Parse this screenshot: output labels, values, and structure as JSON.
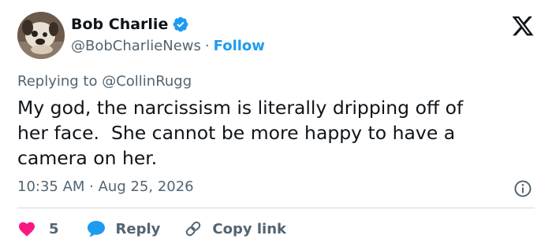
{
  "user": {
    "display_name": "Bob Charlie",
    "handle": "@BobCharlieNews",
    "separator": "·",
    "follow_label": "Follow",
    "verified_color": "#1d9bf0"
  },
  "tweet": {
    "replying_to": "Replying to @CollinRugg",
    "text": "My god, the narcissism is literally dripping off of\nher face.  She cannot be more happy to have a\ncamera on her.",
    "time": "10:35 AM · Aug 25, 2026"
  },
  "actions": {
    "like_count": "5",
    "reply_label": "Reply",
    "copy_link_label": "Copy link"
  },
  "icons": {
    "brand": "x-logo-icon",
    "verified": "verified-badge-icon",
    "info": "info-icon",
    "like": "heart-icon",
    "reply": "speech-bubble-icon",
    "copy": "link-icon"
  },
  "colors": {
    "like": "#f91880",
    "reply": "#1d9bf0",
    "link": "#1d9bf0",
    "text": "#0f1419",
    "muted": "#536471"
  }
}
